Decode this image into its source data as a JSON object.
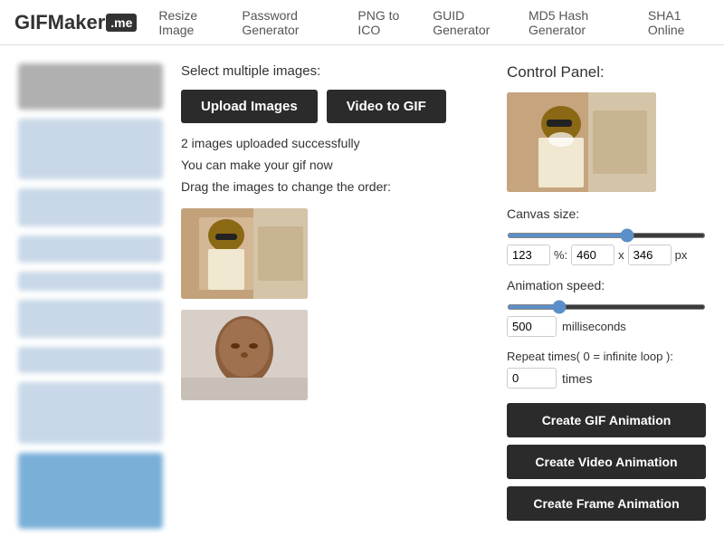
{
  "header": {
    "logo_gif": "GIFMaker",
    "logo_badge": ".me",
    "nav": [
      {
        "label": "Resize Image",
        "url": "#"
      },
      {
        "label": "Password Generator",
        "url": "#"
      },
      {
        "label": "PNG to ICO",
        "url": "#"
      },
      {
        "label": "GUID Generator",
        "url": "#"
      },
      {
        "label": "MD5 Hash Generator",
        "url": "#"
      },
      {
        "label": "SHA1 Online",
        "url": "#"
      }
    ]
  },
  "content": {
    "select_label": "Select multiple images:",
    "upload_btn": "Upload Images",
    "video_btn": "Video to GIF",
    "upload_status": "2 images uploaded successfully",
    "make_gif_text": "You can make your gif now",
    "drag_text": "Drag the images to change the order:"
  },
  "control_panel": {
    "title": "Control Panel:",
    "canvas_label": "Canvas size:",
    "canvas_pct": "123",
    "canvas_pct_symbol": "%:",
    "canvas_width": "460",
    "canvas_x": "x",
    "canvas_height": "346",
    "canvas_px": "px",
    "speed_label": "Animation speed:",
    "speed_value": "500",
    "speed_unit": "milliseconds",
    "repeat_label": "Repeat times( 0 = infinite loop ):",
    "repeat_value": "0",
    "repeat_unit": "times",
    "btn_gif": "Create GIF Animation",
    "btn_video": "Create Video Animation",
    "btn_frame": "Create Frame Animation"
  }
}
